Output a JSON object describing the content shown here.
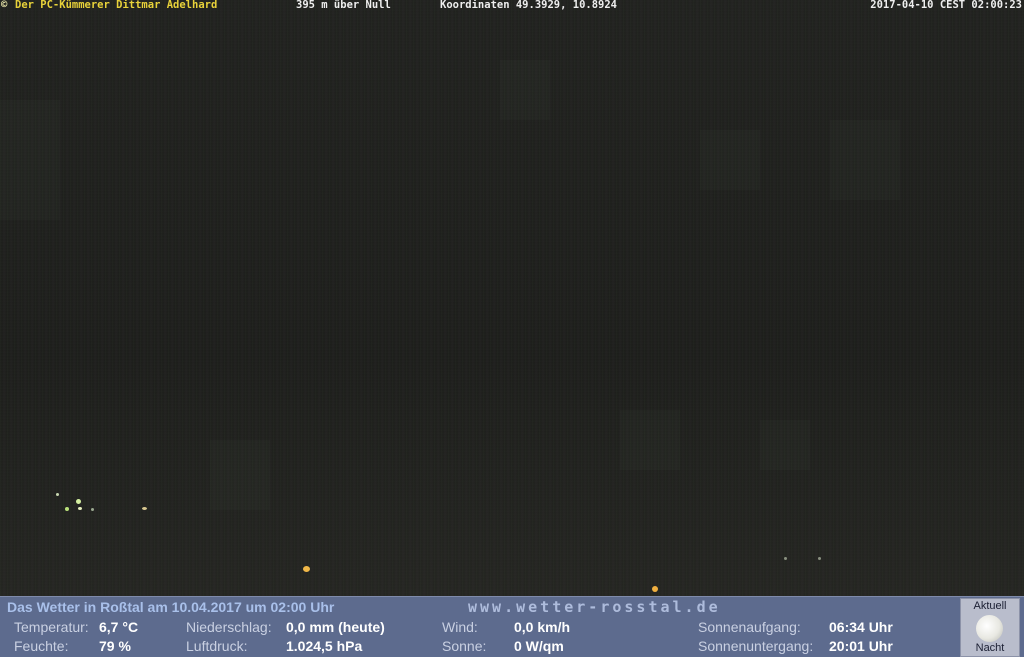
{
  "overlay": {
    "copyright": "©",
    "title": "Der PC-Kümmerer Dittmar Adelhard",
    "altitude": "395 m über Null",
    "coordinates": "Koordinaten 49.3929, 10.8924",
    "timestamp": "2017-04-10 CEST 02:00:23"
  },
  "panel": {
    "heading": "Das Wetter in Roßtal am 10.04.2017 um 02:00 Uhr",
    "website": "www.wetter-rosstal.de",
    "temperature": {
      "label": "Temperatur:",
      "value": "6,7 °C"
    },
    "humidity": {
      "label": "Feuchte:",
      "value": "79 %"
    },
    "precipitation": {
      "label": "Niederschlag:",
      "value": "0,0 mm (heute)"
    },
    "pressure": {
      "label": "Luftdruck:",
      "value": "1.024,5 hPa"
    },
    "wind": {
      "label": "Wind:",
      "value": "0,0 km/h"
    },
    "sun": {
      "label": "Sonne:",
      "value": "0 W/qm"
    },
    "sunrise": {
      "label": "Sonnenaufgang:",
      "value": "06:34 Uhr"
    },
    "sunset": {
      "label": "Sonnenuntergang:",
      "value": "20:01 Uhr"
    },
    "moon": {
      "top_label": "Aktuell",
      "bottom_label": "Nacht",
      "icon": "moon-icon"
    }
  }
}
